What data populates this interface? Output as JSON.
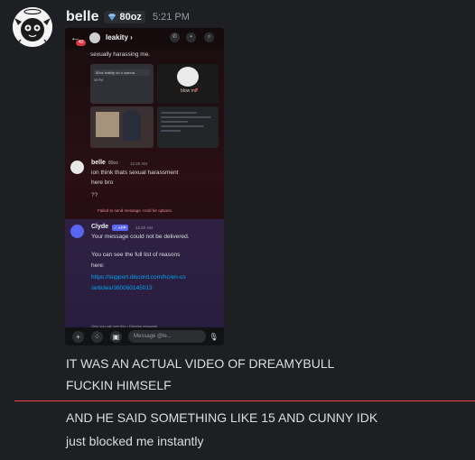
{
  "message1": {
    "username": "belle",
    "tag": "80oz",
    "timestamp": "5:21 PM",
    "attachment": {
      "header": {
        "name": "leakity",
        "chevron": "›",
        "badge": "40"
      },
      "top_text": "sexually harassing me.",
      "thumb1_bar": "80oz leakity do u wanna",
      "thumb1_time": "05 PM",
      "thumb2_text": "blow me",
      "user_msg": {
        "name": "belle",
        "tag": "80oz",
        "time": "12:20 AM",
        "lines": [
          "ion think thats sexual harassment",
          "here bro",
          "??"
        ],
        "failed": "Failed to send message. Hold for options."
      },
      "clyde": {
        "name": "Clyde",
        "app": "✓ APP",
        "time": "12:20 AM",
        "line1": "Your message could not be delivered.",
        "line2": "You can see the full list of reasons",
        "line3": "here:",
        "link1": "https://support.discord.com/hc/en-us",
        "link2": "/articles/360060145013",
        "footer": "Only you can see this • Dismiss message"
      },
      "input_placeholder": "Message @le..."
    },
    "lines": [
      "IT WAS AN ACTUAL VIDEO OF DREAMYBULL",
      "FUCKIN HIMSELF"
    ]
  },
  "message2": {
    "lines": [
      "AND HE SAID SOMETHING LIKE 15 AND CUNNY IDK",
      "just blocked me instantly"
    ]
  },
  "colors": {
    "background": "#1e1f22",
    "divider": "#f23f43",
    "link": "#00a8fc",
    "clyde": "#5865f2"
  }
}
